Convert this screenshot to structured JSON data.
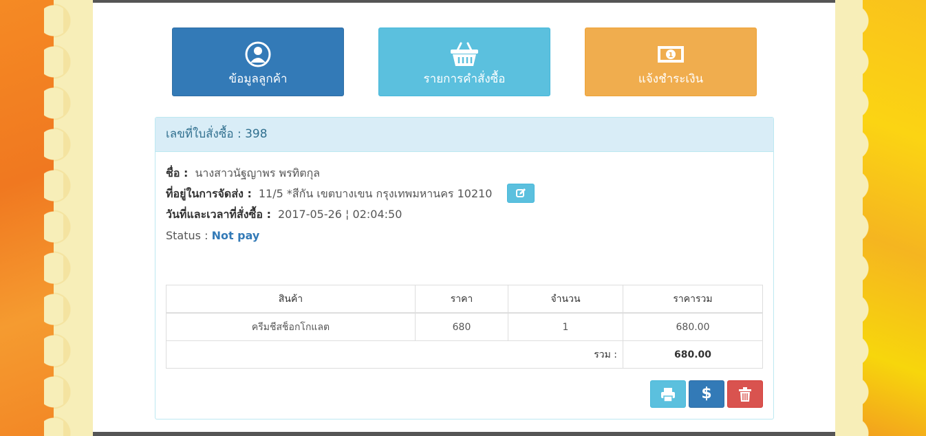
{
  "nav": {
    "customer_info": "ข้อมูลลูกค้า",
    "order_list": "รายการคำสั่งซื้อ",
    "payment_notice": "แจ้งชำระเงิน"
  },
  "order": {
    "header": "เลขที่ใบสั่งซื้อ : 398",
    "name_label": "ชื่อ :",
    "name_value": "นางสาวนัฐญาพร พรทิตกุล",
    "address_label": "ที่อยู่ในการจัดส่ง :",
    "address_value": "11/5 *สีกัน เขตบางเขน กรุงเทพมหานคร 10210",
    "date_label": "วันที่และเวลาที่สั่งซื้อ :",
    "date_value": "2017-05-26 ¦ 02:04:50",
    "status_label": "Status :",
    "status_value": "Not pay"
  },
  "table": {
    "headers": [
      "สินค้า",
      "ราคา",
      "จำนวน",
      "ราคารวม"
    ],
    "rows": [
      [
        "ครีมชีสช็อกโกแลต",
        "680",
        "1",
        "680.00"
      ]
    ],
    "total_label": "รวม :",
    "total_value": "680.00"
  },
  "actions": {
    "pay_symbol": "$"
  },
  "colors": {
    "primary": "#337ab7",
    "info": "#5bc0de",
    "warning": "#f0ad4e",
    "danger": "#d9534f"
  },
  "icons": [
    "user-circle-icon",
    "basket-icon",
    "money-icon",
    "edit-icon",
    "print-icon",
    "trash-icon"
  ]
}
